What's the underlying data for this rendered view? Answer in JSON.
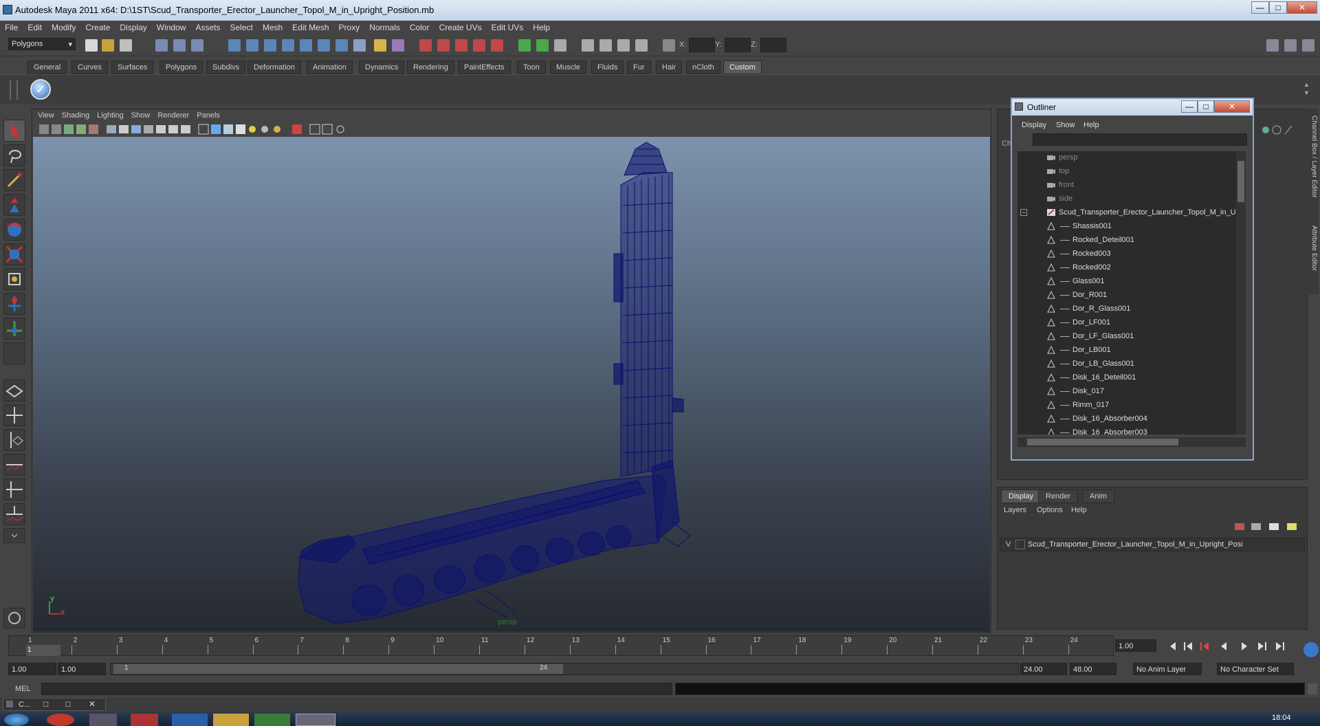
{
  "window": {
    "title": "Autodesk Maya 2011 x64: D:\\1ST\\Scud_Transporter_Erector_Launcher_Topol_M_in_Upright_Position.mb",
    "min": "—",
    "max": "□",
    "close": "✕"
  },
  "menubar": [
    "File",
    "Edit",
    "Modify",
    "Create",
    "Display",
    "Window",
    "Assets",
    "Select",
    "Mesh",
    "Edit Mesh",
    "Proxy",
    "Normals",
    "Color",
    "Create UVs",
    "Edit UVs",
    "Help"
  ],
  "status": {
    "menuset": "Polygons",
    "x_label": "X:",
    "y_label": "Y:",
    "z_label": "Z:"
  },
  "shelf_tabs": [
    "General",
    "Curves",
    "Surfaces",
    "Polygons",
    "Subdivs",
    "Deformation",
    "Animation",
    "Dynamics",
    "Rendering",
    "PaintEffects",
    "Toon",
    "Muscle",
    "Fluids",
    "Fur",
    "Hair",
    "nCloth",
    "Custom"
  ],
  "shelf_active": "Custom",
  "viewport": {
    "menu": [
      "View",
      "Shading",
      "Lighting",
      "Show",
      "Renderer",
      "Panels"
    ],
    "camera_label": "persp",
    "axis_y": "y",
    "axis_x": "x"
  },
  "outliner": {
    "title": "Outliner",
    "menu": [
      "Display",
      "Show",
      "Help"
    ],
    "items": [
      {
        "label": "persp",
        "type": "camera"
      },
      {
        "label": "top",
        "type": "camera"
      },
      {
        "label": "front",
        "type": "camera"
      },
      {
        "label": "side",
        "type": "camera"
      },
      {
        "label": "Scud_Transporter_Erector_Launcher_Topol_M_in_U",
        "type": "group"
      },
      {
        "label": "Shassis001",
        "type": "mesh"
      },
      {
        "label": "Rocked_Deteil001",
        "type": "mesh"
      },
      {
        "label": "Rocked003",
        "type": "mesh"
      },
      {
        "label": "Rocked002",
        "type": "mesh"
      },
      {
        "label": "Glass001",
        "type": "mesh"
      },
      {
        "label": "Dor_R001",
        "type": "mesh"
      },
      {
        "label": "Dor_R_Glass001",
        "type": "mesh"
      },
      {
        "label": "Dor_LF001",
        "type": "mesh"
      },
      {
        "label": "Dor_LF_Glass001",
        "type": "mesh"
      },
      {
        "label": "Dor_LB001",
        "type": "mesh"
      },
      {
        "label": "Dor_LB_Glass001",
        "type": "mesh"
      },
      {
        "label": "Disk_16_Deteil001",
        "type": "mesh"
      },
      {
        "label": "Disk_017",
        "type": "mesh"
      },
      {
        "label": "Rimm_017",
        "type": "mesh"
      },
      {
        "label": "Disk_16_Absorber004",
        "type": "mesh"
      },
      {
        "label": "Disk_16_Absorber003",
        "type": "mesh"
      }
    ]
  },
  "side_tabs": {
    "channel_box": "Channel Box / Layer Editor",
    "attribute_editor": "Attribute Editor",
    "ch_stub": "Ch"
  },
  "layers": {
    "tabs": [
      "Display",
      "Render",
      "Anim"
    ],
    "menu": [
      "Layers",
      "Options",
      "Help"
    ],
    "layer_visible": "V",
    "layer_name": "Scud_Transporter_Erector_Launcher_Topol_M_in_Upright_Posi"
  },
  "timeline": {
    "ticks": [
      "1",
      "2",
      "3",
      "4",
      "5",
      "6",
      "7",
      "8",
      "9",
      "10",
      "11",
      "12",
      "13",
      "14",
      "15",
      "16",
      "17",
      "18",
      "19",
      "20",
      "21",
      "22",
      "23",
      "24"
    ],
    "current_frame": "1",
    "current_field": "1.00"
  },
  "range": {
    "start": "1.00",
    "start2": "1.00",
    "slider_start": "1",
    "slider_end": "24",
    "end": "24.00",
    "end2": "48.00",
    "anim_layer": "No Anim Layer",
    "char_set": "No Character Set"
  },
  "mel": {
    "label": "MEL"
  },
  "taskbar": {
    "item": "C...",
    "clock": "18:04"
  },
  "colors": {
    "wire": "#0d0d6e",
    "viewport_top": "#7c93ad",
    "viewport_bottom": "#262a30",
    "active_tab": "#5a5a5a"
  }
}
